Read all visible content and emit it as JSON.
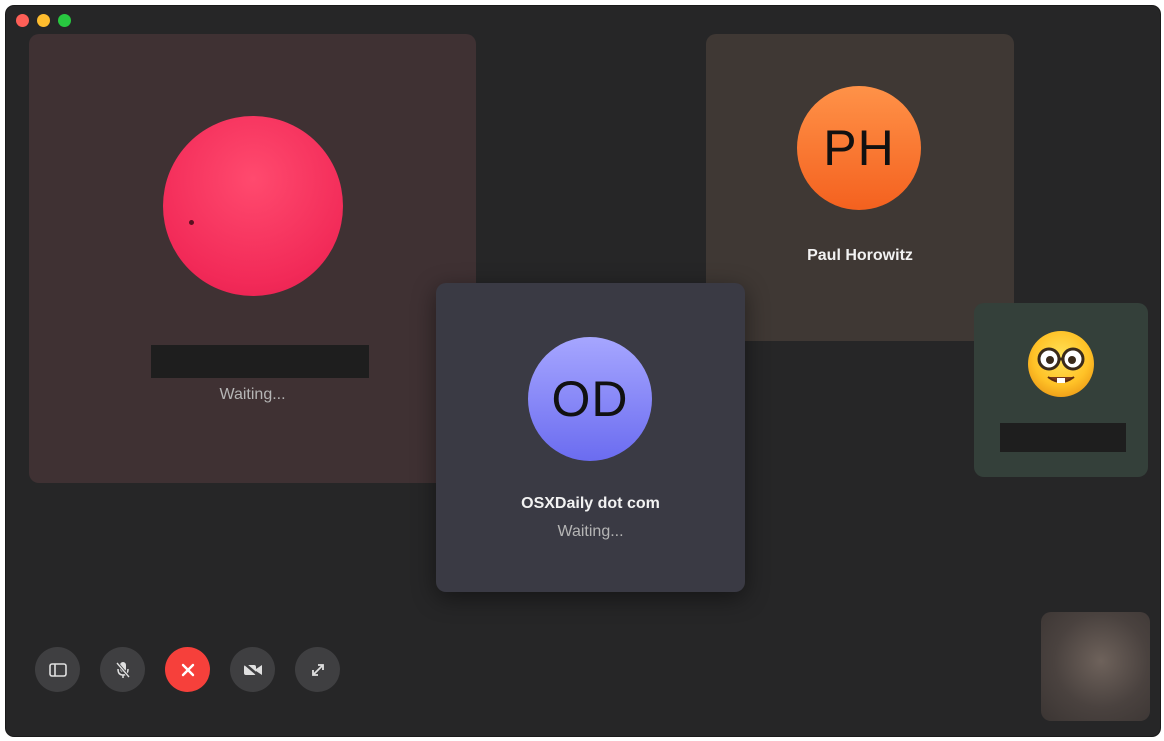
{
  "window": {
    "traffic_lights": [
      "close",
      "minimize",
      "maximize"
    ]
  },
  "participants": [
    {
      "id": "pink",
      "initials": "",
      "name": "",
      "status": "Waiting...",
      "avatar_color": "#f22a58"
    },
    {
      "id": "ph",
      "initials": "PH",
      "name": "Paul Horowitz",
      "status": "",
      "avatar_color": "#f4611f"
    },
    {
      "id": "od",
      "initials": "OD",
      "name": "OSXDaily dot com",
      "status": "Waiting...",
      "avatar_color": "#6b6cf0"
    },
    {
      "id": "emoji",
      "initials": "",
      "name": "",
      "status": "",
      "avatar_icon": "nerd-face-emoji-icon"
    }
  ],
  "controls": [
    {
      "name": "sidebar-button",
      "icon": "sidebar-icon"
    },
    {
      "name": "mute-button",
      "icon": "microphone-muted-icon"
    },
    {
      "name": "end-call-button",
      "icon": "close-icon",
      "color": "#f6403b"
    },
    {
      "name": "camera-button",
      "icon": "video-camera-icon"
    },
    {
      "name": "fullscreen-button",
      "icon": "expand-icon"
    }
  ]
}
